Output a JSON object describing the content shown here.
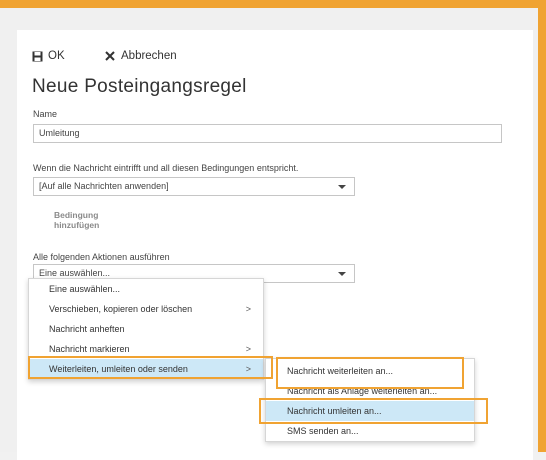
{
  "accent_color": "#f0a332",
  "highlight_color": "#cde8f7",
  "toolbar": {
    "ok_label": "OK",
    "cancel_label": "Abbrechen",
    "ok_icon": "save-icon",
    "cancel_icon": "close-icon"
  },
  "page_title": "Neue Posteingangsregel",
  "name": {
    "label": "Name",
    "value": "Umleitung"
  },
  "conditions": {
    "label": "Wenn die Nachricht eintrifft und all diesen Bedingungen entspricht.",
    "selected": "[Auf alle Nachrichten anwenden]",
    "add_label_line1": "Bedingung",
    "add_label_line2": "hinzufügen"
  },
  "actions": {
    "label": "Alle folgenden Aktionen ausführen",
    "selected": "Eine auswählen..."
  },
  "menu": {
    "items": [
      {
        "label": "Eine auswählen...",
        "submenu": ""
      },
      {
        "label": "Verschieben, kopieren oder löschen",
        "submenu": ">"
      },
      {
        "label": "Nachricht anheften",
        "submenu": ""
      },
      {
        "label": "Nachricht markieren",
        "submenu": ">"
      },
      {
        "label": "Weiterleiten, umleiten oder senden",
        "submenu": ">"
      }
    ]
  },
  "submenu": {
    "items": [
      {
        "label": "Nachricht weiterleiten an..."
      },
      {
        "label": "Nachricht als Anlage weiterleiten an..."
      },
      {
        "label": "Nachricht umleiten an..."
      },
      {
        "label": "SMS senden an..."
      }
    ]
  }
}
